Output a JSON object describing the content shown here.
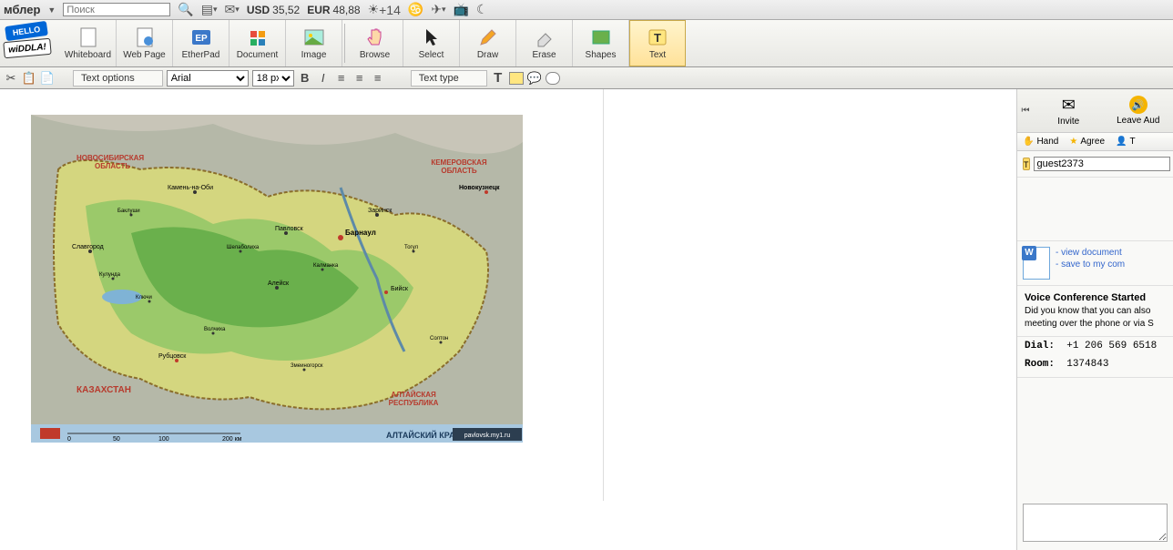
{
  "topbar": {
    "brand": "мблер",
    "search_placeholder": "Поиск",
    "usd_label": "USD",
    "usd_value": "35,52",
    "eur_label": "EUR",
    "eur_value": "48,88",
    "weather": "+14"
  },
  "toolbar": {
    "badge_top": "HELLO",
    "badge_bot": "wiDDLA!",
    "items": [
      {
        "label": "Whiteboard"
      },
      {
        "label": "Web Page"
      },
      {
        "label": "EtherPad"
      },
      {
        "label": "Document"
      },
      {
        "label": "Image"
      },
      {
        "label": "Browse"
      },
      {
        "label": "Select"
      },
      {
        "label": "Draw"
      },
      {
        "label": "Erase"
      },
      {
        "label": "Shapes"
      },
      {
        "label": "Text"
      }
    ]
  },
  "textbar": {
    "text_options": "Text options",
    "font": "Arial",
    "size": "18 px",
    "text_type": "Text type"
  },
  "side": {
    "invite": "Invite",
    "leave": "Leave Aud",
    "hand": "Hand",
    "agree": "Agree",
    "guest": "guest2373",
    "view_doc": "- view document",
    "save_doc": "- save to my com",
    "voice_title": "Voice Conference Started",
    "voice_text": "Did you know that you can also meeting over the phone or via S",
    "dial_label": "Dial:",
    "dial_value": "+1 206 569 6518",
    "room_label": "Room:",
    "room_value": "1374843"
  },
  "map": {
    "title": "АЛТАЙСКИЙ КРАЙ",
    "credit": "pavlovsk.my1.ru",
    "regions": {
      "novosibirsk": "НОВОСИБИРСКАЯ ОБЛАСТЬ",
      "kemerovo": "КЕМЕРОВСКАЯ ОБЛАСТЬ",
      "kazakhstan": "КАЗАХСТАН",
      "altai_rep": "АЛТАЙСКАЯ РЕСПУБЛИКА"
    },
    "cities": {
      "barnaul": "Барнаул",
      "novokuznetsk": "Новокузнецк",
      "biysk": "Бийск",
      "rubtsovsk": "Рубцовск",
      "pavlovsk": "Павловск",
      "kamen": "Камень-на-Оби",
      "slavgorod": "Славгород",
      "aleysk": "Алейск",
      "zarinsk": "Заринск"
    },
    "scale": {
      "s1": "0",
      "s2": "50",
      "s3": "100",
      "s4": "200 км"
    }
  }
}
